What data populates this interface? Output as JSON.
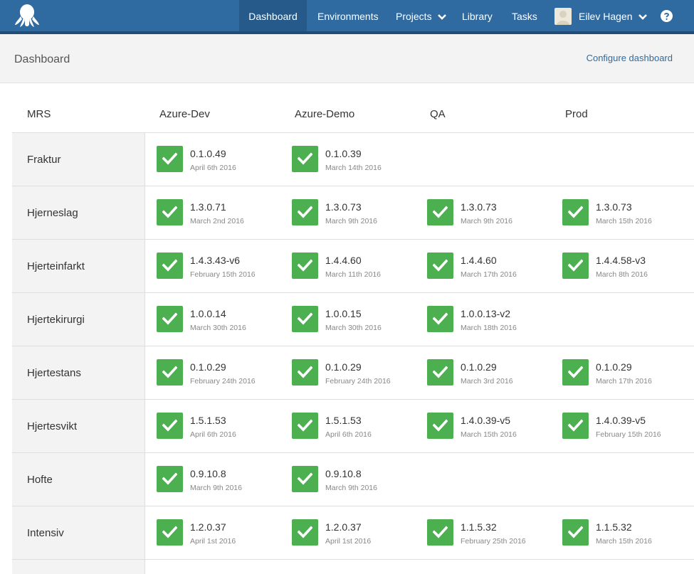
{
  "nav": {
    "items": [
      {
        "label": "Dashboard"
      },
      {
        "label": "Environments"
      },
      {
        "label": "Projects"
      },
      {
        "label": "Library"
      },
      {
        "label": "Tasks"
      }
    ],
    "user": "Eilev Hagen"
  },
  "header": {
    "title": "Dashboard",
    "configure": "Configure dashboard"
  },
  "table": {
    "project_group": "MRS",
    "environments": [
      "Azure-Dev",
      "Azure-Demo",
      "QA",
      "Prod"
    ],
    "rows": [
      {
        "name": "Fraktur",
        "cells": [
          {
            "version": "0.1.0.49",
            "date": "April 6th 2016"
          },
          {
            "version": "0.1.0.39",
            "date": "March 14th 2016"
          },
          null,
          null
        ]
      },
      {
        "name": "Hjerneslag",
        "cells": [
          {
            "version": "1.3.0.71",
            "date": "March 2nd 2016"
          },
          {
            "version": "1.3.0.73",
            "date": "March 9th 2016"
          },
          {
            "version": "1.3.0.73",
            "date": "March 9th 2016"
          },
          {
            "version": "1.3.0.73",
            "date": "March 15th 2016"
          }
        ]
      },
      {
        "name": "Hjerteinfarkt",
        "cells": [
          {
            "version": "1.4.3.43-v6",
            "date": "February 15th 2016"
          },
          {
            "version": "1.4.4.60",
            "date": "March 11th 2016"
          },
          {
            "version": "1.4.4.60",
            "date": "March 17th 2016"
          },
          {
            "version": "1.4.4.58-v3",
            "date": "March 8th 2016"
          }
        ]
      },
      {
        "name": "Hjertekirurgi",
        "cells": [
          {
            "version": "1.0.0.14",
            "date": "March 30th 2016"
          },
          {
            "version": "1.0.0.15",
            "date": "March 30th 2016"
          },
          {
            "version": "1.0.0.13-v2",
            "date": "March 18th 2016"
          },
          null
        ]
      },
      {
        "name": "Hjertestans",
        "cells": [
          {
            "version": "0.1.0.29",
            "date": "February 24th 2016"
          },
          {
            "version": "0.1.0.29",
            "date": "February 24th 2016"
          },
          {
            "version": "0.1.0.29",
            "date": "March 3rd 2016"
          },
          {
            "version": "0.1.0.29",
            "date": "March 17th 2016"
          }
        ]
      },
      {
        "name": "Hjertesvikt",
        "cells": [
          {
            "version": "1.5.1.53",
            "date": "April 6th 2016"
          },
          {
            "version": "1.5.1.53",
            "date": "April 6th 2016"
          },
          {
            "version": "1.4.0.39-v5",
            "date": "March 15th 2016"
          },
          {
            "version": "1.4.0.39-v5",
            "date": "February 15th 2016"
          }
        ]
      },
      {
        "name": "Hofte",
        "cells": [
          {
            "version": "0.9.10.8",
            "date": "March 9th 2016"
          },
          {
            "version": "0.9.10.8",
            "date": "March 9th 2016"
          },
          null,
          null
        ]
      },
      {
        "name": "Intensiv",
        "cells": [
          {
            "version": "1.2.0.37",
            "date": "April 1st 2016"
          },
          {
            "version": "1.2.0.37",
            "date": "April 1st 2016"
          },
          {
            "version": "1.1.5.32",
            "date": "February 25th 2016"
          },
          {
            "version": "1.1.5.32",
            "date": "March 15th 2016"
          }
        ]
      }
    ]
  },
  "icons": {
    "logo": "octopus-logo",
    "caret": "chevron-down-icon",
    "status": "check-icon",
    "help": "question-circle-icon"
  },
  "colors": {
    "nav_bg": "#2f6aa0",
    "nav_active": "#255a8a",
    "success": "#4caf50",
    "link": "#2f6aa0"
  }
}
